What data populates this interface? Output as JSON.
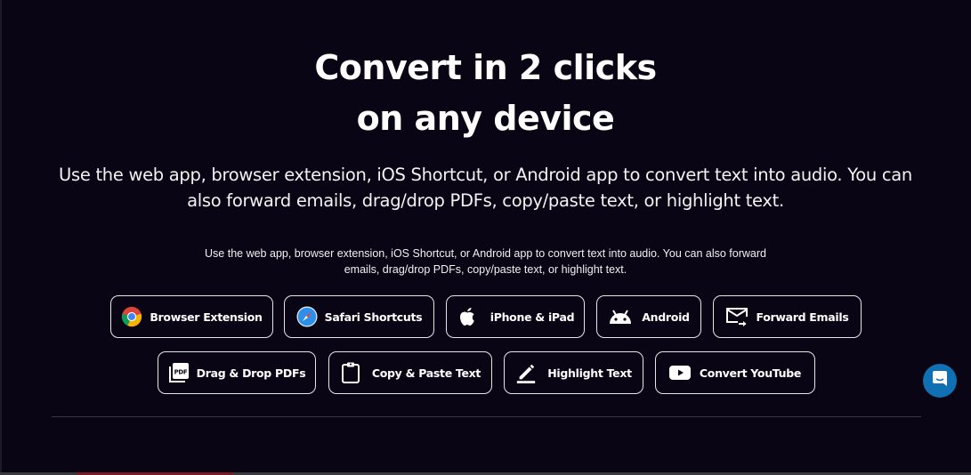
{
  "hero": {
    "title_line1": "Convert in 2 clicks",
    "title_line2": "on any device",
    "lead": "Use the web app, browser extension, iOS Shortcut, or Android app to convert text into audio. You can also forward emails, drag/drop PDFs, copy/paste text, or highlight text.",
    "sub": "Use the web app, browser extension, iOS Shortcut, or Android app to convert text into audio. You can also forward emails, drag/drop PDFs, copy/paste text, or highlight text."
  },
  "buttons_row1": [
    {
      "label": "Browser Extension",
      "icon": "chrome-icon"
    },
    {
      "label": "Safari Shortcuts",
      "icon": "safari-icon"
    },
    {
      "label": "iPhone & iPad",
      "icon": "apple-icon"
    },
    {
      "label": "Android",
      "icon": "android-icon"
    },
    {
      "label": "Forward Emails",
      "icon": "email-forward-icon"
    }
  ],
  "buttons_row2": [
    {
      "label": "Drag & Drop PDFs",
      "icon": "pdf-icon"
    },
    {
      "label": "Copy & Paste Text",
      "icon": "clipboard-icon"
    },
    {
      "label": "Highlight Text",
      "icon": "pencil-highlight-icon"
    },
    {
      "label": "Convert YouTube",
      "icon": "youtube-icon"
    }
  ],
  "chat_widget": {
    "icon": "chat-bubble-icon",
    "color": "#0f70b3"
  },
  "colors": {
    "background": "#090514",
    "text": "#ffffff",
    "border": "#e6e6e6"
  }
}
